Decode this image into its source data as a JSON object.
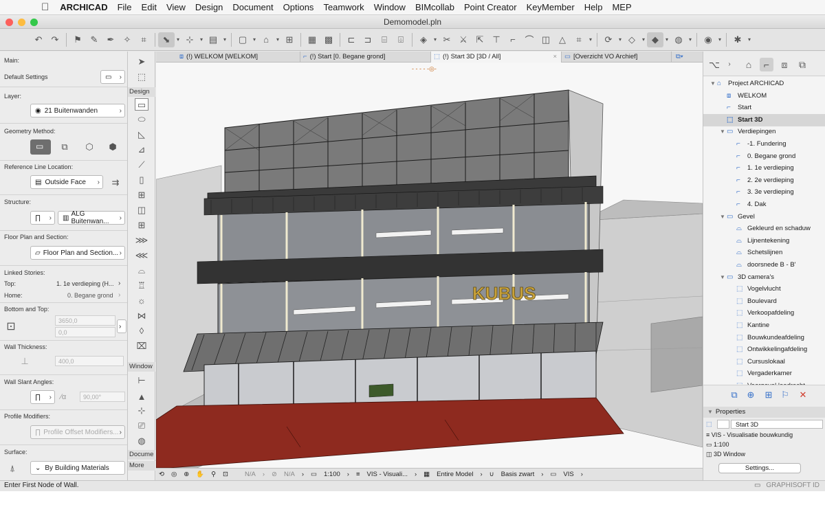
{
  "menubar": {
    "app": "ARCHICAD",
    "items": [
      "File",
      "Edit",
      "View",
      "Design",
      "Document",
      "Options",
      "Teamwork",
      "Window",
      "BIMcollab",
      "Point Creator",
      "KeyMember",
      "Help",
      "MEP"
    ]
  },
  "window": {
    "title": "Demomodel.pln"
  },
  "infobox": {
    "main_label": "Main:",
    "default_settings": "Default Settings",
    "layer_label": "Layer:",
    "layer_value": "21 Buitenwanden",
    "geometry_label": "Geometry Method:",
    "refline_label": "Reference Line Location:",
    "refline_value": "Outside Face",
    "structure_label": "Structure:",
    "structure_value": "ALG Buitenwan...",
    "floorplan_label": "Floor Plan and Section:",
    "floorplan_value": "Floor Plan and Section...",
    "linked_label": "Linked Stories:",
    "top_label": "Top:",
    "top_value": "1. 1e verdieping (H...",
    "home_label": "Home:",
    "home_value": "0. Begane grond",
    "bottomtop_label": "Bottom and Top:",
    "height_value": "3650,0",
    "offset_value": "0,0",
    "thickness_label": "Wall Thickness:",
    "thickness_value": "400,0",
    "slant_label": "Wall Slant Angles:",
    "slant_value": "90,00°",
    "profile_label": "Profile Modifiers:",
    "profile_value": "Profile Offset Modifiers...",
    "surface_label": "Surface:",
    "surface_value": "By Building Materials"
  },
  "toolbox": {
    "design": "Design",
    "window": "Window",
    "document": "Docume",
    "more": "More"
  },
  "tabs": [
    {
      "label": "(!) WELKOM [WELKOM]"
    },
    {
      "label": "(!) Start [0. Begane grond]"
    },
    {
      "label": "(!) Start 3D [3D / All]"
    },
    {
      "label": "[Overzicht VO Archief]"
    }
  ],
  "viewport": {
    "sign_text": "KUBUS"
  },
  "bottombar": {
    "na1": "N/A",
    "na2": "N/A",
    "scale": "1:100",
    "layers": "VIS - Visuali...",
    "model": "Entire Model",
    "pen": "Basis zwart",
    "override": "VIS"
  },
  "navigator": {
    "items": [
      {
        "label": "Project ARCHICAD",
        "icon": "project-icon",
        "level": 0,
        "twisty": "▼"
      },
      {
        "label": "WELKOM",
        "icon": "layout-icon",
        "level": 1,
        "twisty": ""
      },
      {
        "label": "Start",
        "icon": "floorplan-icon",
        "level": 1,
        "twisty": ""
      },
      {
        "label": "Start 3D",
        "icon": "3d-icon",
        "level": 1,
        "twisty": "",
        "selected": true
      },
      {
        "label": "Verdiepingen",
        "icon": "folder-icon",
        "level": 1,
        "twisty": "▼"
      },
      {
        "label": "-1. Fundering",
        "icon": "floorplan-icon",
        "level": 2,
        "twisty": ""
      },
      {
        "label": "0. Begane grond",
        "icon": "floorplan-icon",
        "level": 2,
        "twisty": ""
      },
      {
        "label": "1. 1e verdieping",
        "icon": "floorplan-icon",
        "level": 2,
        "twisty": ""
      },
      {
        "label": "2. 2e verdieping",
        "icon": "floorplan-icon",
        "level": 2,
        "twisty": ""
      },
      {
        "label": "3. 3e verdieping",
        "icon": "floorplan-icon",
        "level": 2,
        "twisty": ""
      },
      {
        "label": "4. Dak",
        "icon": "floorplan-icon",
        "level": 2,
        "twisty": ""
      },
      {
        "label": "Gevel",
        "icon": "folder-icon",
        "level": 1,
        "twisty": "▼"
      },
      {
        "label": "Gekleurd en schaduw",
        "icon": "elevation-icon",
        "level": 2,
        "twisty": ""
      },
      {
        "label": "Lijnentekening",
        "icon": "elevation-icon",
        "level": 2,
        "twisty": ""
      },
      {
        "label": "Schetslijnen",
        "icon": "elevation-icon",
        "level": 2,
        "twisty": ""
      },
      {
        "label": "doorsnede B - B'",
        "icon": "elevation-icon",
        "level": 2,
        "twisty": ""
      },
      {
        "label": "3D camera's",
        "icon": "folder-icon",
        "level": 1,
        "twisty": "▼"
      },
      {
        "label": "Vogelvlucht",
        "icon": "3d-icon",
        "level": 2,
        "twisty": ""
      },
      {
        "label": "Boulevard",
        "icon": "3d-icon",
        "level": 2,
        "twisty": ""
      },
      {
        "label": "Verkoopafdeling",
        "icon": "3d-icon",
        "level": 2,
        "twisty": ""
      },
      {
        "label": "Kantine",
        "icon": "3d-icon",
        "level": 2,
        "twisty": ""
      },
      {
        "label": "Bouwkundeafdeling",
        "icon": "3d-icon",
        "level": 2,
        "twisty": ""
      },
      {
        "label": "Ontwikkelingafdeling",
        "icon": "3d-icon",
        "level": 2,
        "twisty": ""
      },
      {
        "label": "Cursuslokaal",
        "icon": "3d-icon",
        "level": 2,
        "twisty": ""
      },
      {
        "label": "Vergaderkamer",
        "icon": "3d-icon",
        "level": 2,
        "twisty": ""
      },
      {
        "label": "Voorgevel loodrecht",
        "icon": "3d-icon",
        "level": 2,
        "twisty": ""
      }
    ]
  },
  "properties": {
    "header": "Properties",
    "name": "Start 3D",
    "layer_combo": "VIS - Visualisatie bouwkundig",
    "scale": "1:100",
    "window_type": "3D Window",
    "settings_button": "Settings..."
  },
  "status": {
    "message": "Enter First Node of Wall.",
    "brand": "GRAPHISOFT ID"
  },
  "colors": {
    "accent": "#3670c9",
    "ground": "#8e2a1f",
    "sign": "#c9a23a"
  }
}
